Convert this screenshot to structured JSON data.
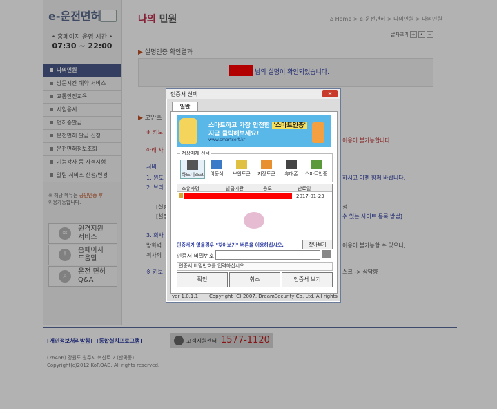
{
  "header": {
    "logo": "e-운전면허",
    "hours_label": "• 홈페이지 운영 시간 •",
    "hours": "07:30 ~ 22:00",
    "page_title_prefix": "나의",
    "page_title": "민원",
    "breadcrumb": "⌂ Home  >  e-운전면허  >  나의민원  >  나의민원",
    "text_size_label": "글자크기",
    "text_size_plus": "+",
    "text_size_reset": "•",
    "text_size_minus": "−"
  },
  "sidebar": {
    "items": [
      {
        "label": "나의민원",
        "active": true
      },
      {
        "label": "방문시간 예약 서비스"
      },
      {
        "label": "교통안전교육"
      },
      {
        "label": "시험응시"
      },
      {
        "label": "면허증발급"
      },
      {
        "label": "운전면허 발급 신청"
      },
      {
        "label": "운전면허정보조회"
      },
      {
        "label": "기능강사 등 자격시험"
      },
      {
        "label": "알림 서비스 신청/변경"
      }
    ],
    "note_prefix": "※ 해당 메뉴는 ",
    "note_highlight": "공인인증 후",
    "note_suffix": "이용가능합니다.",
    "buttons": [
      {
        "line1": "원격지원",
        "line2": "서비스",
        "icon": "wifi-icon"
      },
      {
        "line1": "홈페이지",
        "line2": "도움말",
        "icon": "info-icon"
      },
      {
        "line1": "운전 면허",
        "line2": "Q&A",
        "icon": "search-icon"
      }
    ]
  },
  "main": {
    "section1_title": "실명인증 확인결과",
    "result_text": "님의 실명이 확인되었습니다.",
    "section2_title": "보안프",
    "warn1_left": "※ 키보",
    "warn1_right": "이용이 불가능합니다.",
    "warn2_left": "아래 사",
    "sub_title": "서비",
    "step1_left": "1. 윈도",
    "step1_right": "하시고 이젠 함께 바랍니다.",
    "step2_left": "2. 브라",
    "bracket1_left": "[설정",
    "bracket1_right": "정",
    "bracket2_left": "[설정",
    "bracket2_right": "수 있는 사이트 등록 방법]",
    "step3_left": "3. 회사",
    "body1_left": "방화벽",
    "body1_right": "이용이 불가능할 수 있으니,",
    "body2_left": "귀사의",
    "footer_note_left": "※ 키보",
    "footer_note_right": "스크 -> 삼담향"
  },
  "footer": {
    "link1": "[개인정보처리방침]",
    "link2": "[통합설치프로그램]",
    "call_label": "고객지원센터",
    "call_number": "1577-1120",
    "address": "(26466) 강원도 원주시 혁신로 2 (반곡동)",
    "copyright": "Copyright(c)2012 KoROAD. All rights reserved."
  },
  "dialog": {
    "title": "인증서 선택",
    "close": "✕",
    "tab": "일반",
    "banner_line1_a": "스마트하고 가장 안전한 ",
    "banner_line1_b": "'스마트인증'",
    "banner_line2": "지금 클릭해보세요!",
    "banner_line3": "www.smartcert.kr",
    "media_caption": "저장매체 선택",
    "media": [
      {
        "label": "하드디스크",
        "selected": true
      },
      {
        "label": "이동식"
      },
      {
        "label": "보안토큰"
      },
      {
        "label": "저장토큰"
      },
      {
        "label": "휴대폰"
      },
      {
        "label": "스마트인증"
      }
    ],
    "columns": [
      "소유자명",
      "발급기관",
      "용도",
      "만료일"
    ],
    "row_date": "2017-01-23",
    "notice": "인증서가 없을경우 \"찾아보기\" 버튼을 이용하십시오.",
    "find_button": "찾아보기",
    "pw_label": "인증서 비밀번호",
    "status": "인증서 비밀번호를 입력하십시오.",
    "btn_ok": "확인",
    "btn_cancel": "취소",
    "btn_view": "인증서 보기",
    "version": "ver 1.0.1.1",
    "copyright": "Copyright (C) 2007, DreamSecurity Co, Ltd, All rights"
  }
}
